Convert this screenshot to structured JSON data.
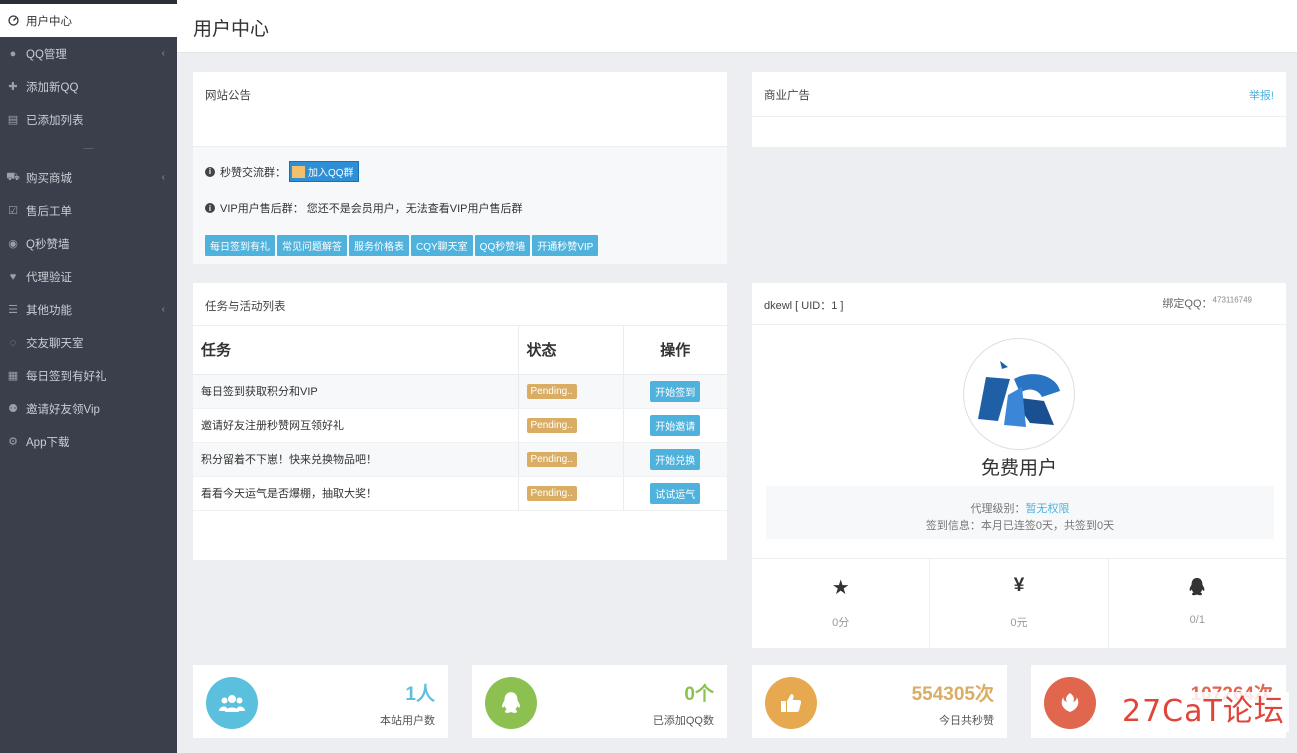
{
  "sidebar": {
    "items": [
      {
        "label": "用户中心",
        "icon": "dashboard-icon"
      },
      {
        "label": "QQ管理",
        "icon": "user-icon"
      },
      {
        "label": "添加新QQ",
        "icon": "plus-icon"
      },
      {
        "label": "已添加列表",
        "icon": "list-icon"
      },
      {
        "label": "购买商城",
        "icon": "cart-icon"
      },
      {
        "label": "售后工单",
        "icon": "check-square-icon"
      },
      {
        "label": "Q秒赞墙",
        "icon": "qq-icon"
      },
      {
        "label": "代理验证",
        "icon": "heart-icon"
      },
      {
        "label": "其他功能",
        "icon": "menu-icon"
      },
      {
        "label": "交友聊天室",
        "icon": "chat-icon"
      },
      {
        "label": "每日签到有好礼",
        "icon": "calendar-icon"
      },
      {
        "label": "邀请好友领Vip",
        "icon": "users-icon"
      },
      {
        "label": "App下载",
        "icon": "android-icon"
      }
    ],
    "separator": "—"
  },
  "header": {
    "title": "用户中心"
  },
  "notice": {
    "title": "网站公告",
    "group_label": "秒赞交流群：",
    "join_button": "加入QQ群",
    "vip_text": "VIP用户售后群：  您还不是会员用户，无法查看VIP用户售后群",
    "buttons": [
      "每日签到有礼",
      "常见问题解答",
      "服务价格表",
      "CQY聊天室",
      "QQ秒赞墙",
      "开通秒赞VIP"
    ]
  },
  "ad": {
    "title": "商业广告",
    "report": "举报!"
  },
  "tasks": {
    "title": "任务与活动列表",
    "headers": [
      "任务",
      "状态",
      "操作"
    ],
    "rows": [
      {
        "task": "每日签到获取积分和VIP",
        "status": "Pending..",
        "action": "开始签到"
      },
      {
        "task": "邀请好友注册秒赞网互领好礼",
        "status": "Pending..",
        "action": "开始邀请"
      },
      {
        "task": "积分留着不下崽！快来兑换物品吧！",
        "status": "Pending..",
        "action": "开始兑换"
      },
      {
        "task": "看看今天运气是否爆棚，抽取大奖！",
        "status": "Pending..",
        "action": "试试运气"
      }
    ]
  },
  "profile": {
    "user": "dkewl [ UID：1 ]",
    "bind_label": "绑定QQ：",
    "bind_qq": "473116749",
    "role": "免费用户",
    "agent_label": "代理级别：",
    "agent_value": "暂无权限",
    "signin_info": "签到信息：本月已连签0天，共签到0天",
    "stats": [
      {
        "icon": "star-icon",
        "glyph": "★",
        "value": "0分"
      },
      {
        "icon": "yen-icon",
        "glyph": "¥",
        "value": "0元"
      },
      {
        "icon": "qq-icon",
        "glyph": "",
        "value": "0/1"
      }
    ]
  },
  "stats": [
    {
      "value": "1人",
      "label": "本站用户数",
      "color": "#5bc0de",
      "icon": "users-icon"
    },
    {
      "value": "0个",
      "label": "已添加QQ数",
      "color": "#8cc152",
      "icon": "qq-icon"
    },
    {
      "value": "554305次",
      "label": "今日共秒赞",
      "color": "#e6a94f",
      "icon": "thumbs-up-icon"
    },
    {
      "value": "107264次",
      "label": "",
      "color": "#e0664e",
      "icon": "rebel-icon"
    }
  ],
  "watermark": "27CaT论坛"
}
